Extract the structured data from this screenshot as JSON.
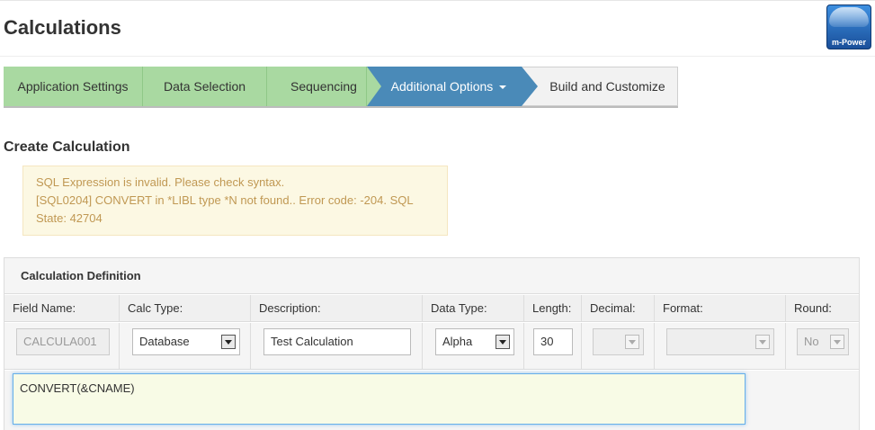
{
  "page": {
    "title": "Calculations"
  },
  "logo": {
    "text": "m-Power"
  },
  "wizard": {
    "steps": [
      {
        "label": "Application Settings",
        "state": "done"
      },
      {
        "label": "Data Selection",
        "state": "done"
      },
      {
        "label": "Sequencing",
        "state": "done"
      },
      {
        "label": "Additional Options",
        "state": "active"
      },
      {
        "label": "Build and Customize",
        "state": "next"
      }
    ]
  },
  "section": {
    "title": "Create Calculation"
  },
  "alert": {
    "line1": "SQL Expression is invalid. Please check syntax.",
    "line2": "[SQL0204] CONVERT in *LIBL type *N not found.. Error code: -204. SQL State: 42704"
  },
  "panel": {
    "title": "Calculation Definition",
    "headers": {
      "field_name": "Field Name:",
      "calc_type": "Calc Type:",
      "description": "Description:",
      "data_type": "Data Type:",
      "length": "Length:",
      "decimal": "Decimal:",
      "format": "Format:",
      "round": "Round:"
    },
    "values": {
      "field_name": "CALCULA001",
      "calc_type": "Database",
      "description": "Test Calculation",
      "data_type": "Alpha",
      "length": "30",
      "decimal": "",
      "format": "",
      "round": "No"
    },
    "expression": "CONVERT(&CNAME)"
  },
  "colors": {
    "step_done": "#a9d9a1",
    "step_active": "#4a8ab8",
    "alert_bg": "#fcf8e3",
    "alert_text": "#c09853"
  }
}
